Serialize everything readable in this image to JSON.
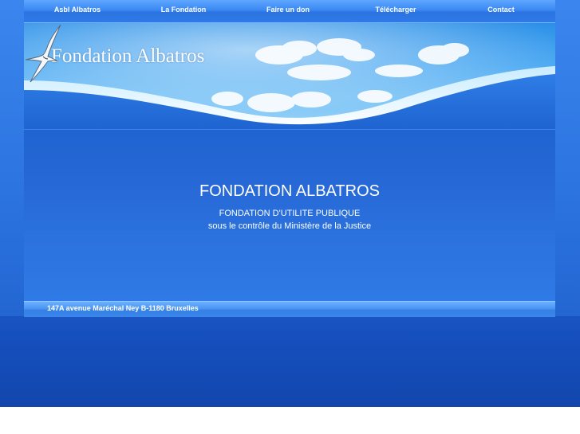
{
  "nav": {
    "items": [
      {
        "label": "Asbl Albatros"
      },
      {
        "label": "La Fondation"
      },
      {
        "label": "Faire un don"
      },
      {
        "label": "Télécharger"
      },
      {
        "label": "Contact"
      }
    ]
  },
  "banner": {
    "title": "Fondation Albatros",
    "logo_icon": "albatros-bird-icon"
  },
  "main": {
    "heading": "FONDATION ALBATROS",
    "subtitle_line1": "FONDATION D'UTILITE PUBLIQUE",
    "subtitle_line2": "sous le contrôle du Ministère de la Justice"
  },
  "footer": {
    "address": "147A avenue Maréchal Ney B-1180 Bruxelles"
  },
  "colors": {
    "background": "#2a70dc",
    "nav_bar": "#3a88f2",
    "footer_bar": "#4a96f2",
    "text": "#ffffff"
  }
}
